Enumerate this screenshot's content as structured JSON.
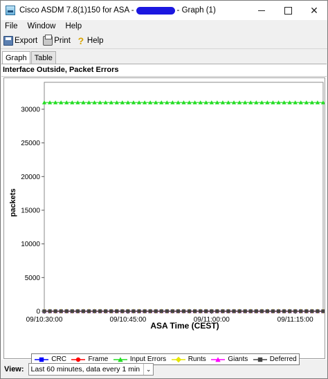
{
  "window": {
    "title_prefix": "Cisco ASDM 7.8(1)150 for ASA -",
    "title_suffix": "- Graph (1)",
    "minimize_glyph": "",
    "maximize_glyph": "",
    "close_glyph": "✕"
  },
  "menu": {
    "file": "File",
    "window": "Window",
    "help": "Help"
  },
  "toolbar": {
    "export": "Export",
    "print": "Print",
    "help": "Help",
    "icons": [
      "floppy-export-icon",
      "printer-icon",
      "question-mark-icon"
    ]
  },
  "tabs": [
    {
      "label": "Graph",
      "active": true
    },
    {
      "label": "Table",
      "active": false
    }
  ],
  "panel": {
    "title": "Interface Outside, Packet Errors"
  },
  "view": {
    "label": "View:",
    "selected": "Last 60 minutes, data every 1 min"
  },
  "chart_data": {
    "type": "line",
    "xlabel": "ASA Time (CEST)",
    "ylabel": "packets",
    "x_tick_labels": [
      "09/10:30:00",
      "09/10:45:00",
      "09/11:00:00",
      "09/11:15:00"
    ],
    "x_range_minutes": [
      0,
      50
    ],
    "x_ticks_minutes": [
      0,
      15,
      30,
      45
    ],
    "y_ticks": [
      0,
      5000,
      10000,
      15000,
      20000,
      25000,
      30000
    ],
    "ylim": [
      0,
      34000
    ],
    "grid": true,
    "legend_position": "bottom",
    "series": [
      {
        "name": "CRC",
        "color": "#0000ff",
        "marker": "square",
        "value": 0
      },
      {
        "name": "Frame",
        "color": "#ff0000",
        "marker": "circle",
        "value": 0
      },
      {
        "name": "Input Errors",
        "color": "#22dd22",
        "marker": "triangle",
        "value": 31000
      },
      {
        "name": "Runts",
        "color": "#e6e600",
        "marker": "diamond",
        "value": 0
      },
      {
        "name": "Giants",
        "color": "#ff00ff",
        "marker": "triangle",
        "value": 0
      },
      {
        "name": "Deferred",
        "color": "#444444",
        "marker": "square",
        "value": 0
      }
    ],
    "points_per_series": 51
  }
}
